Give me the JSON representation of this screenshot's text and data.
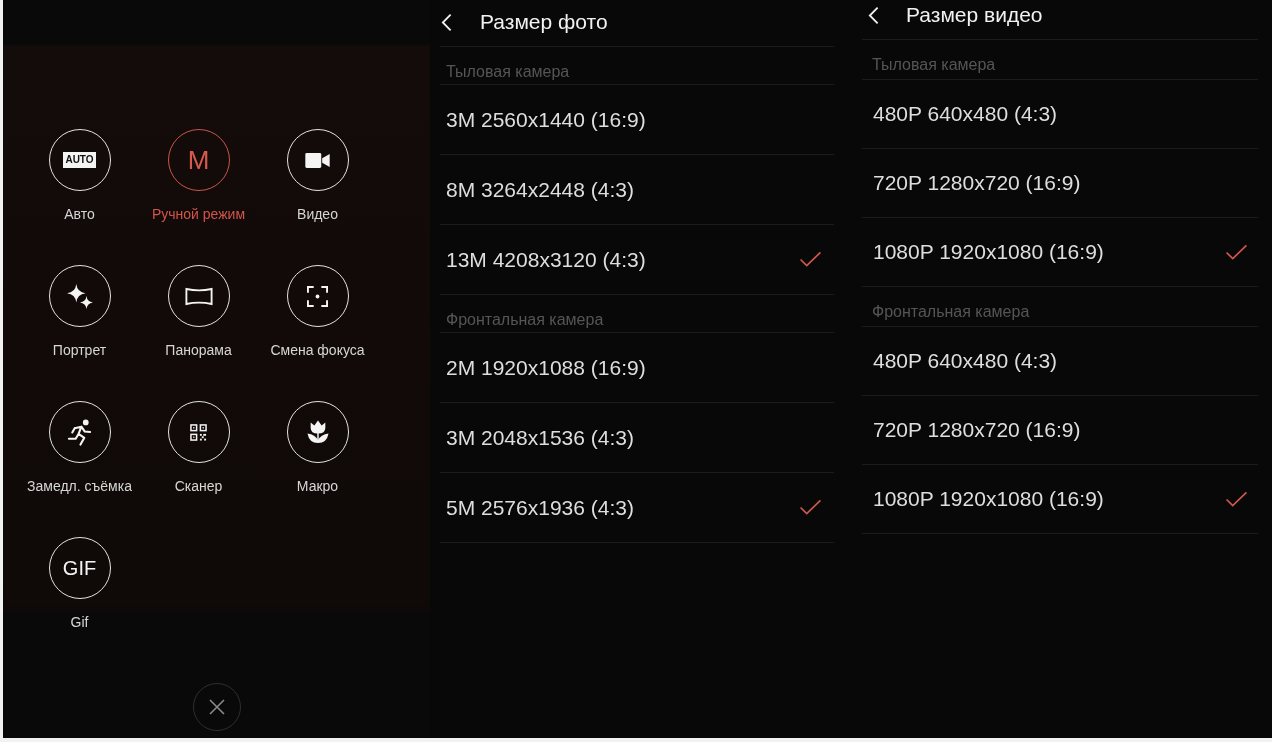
{
  "mode_menu": {
    "modes": [
      {
        "kind": "auto",
        "icon_text": "AUTO",
        "label": "Авто",
        "selected": false
      },
      {
        "kind": "manual",
        "icon_text": "M",
        "label": "Ручной режим",
        "selected": true
      },
      {
        "kind": "video",
        "label": "Видео",
        "selected": false
      },
      {
        "kind": "portrait",
        "label": "Портрет",
        "selected": false
      },
      {
        "kind": "panorama",
        "label": "Панорама",
        "selected": false
      },
      {
        "kind": "refocus",
        "label": "Смена фокуса",
        "selected": false
      },
      {
        "kind": "slowmo",
        "label": "Замедл. съёмка",
        "selected": false
      },
      {
        "kind": "scanner",
        "label": "Сканер",
        "selected": false
      },
      {
        "kind": "macro",
        "label": "Макро",
        "selected": false
      },
      {
        "kind": "gif",
        "icon_text": "GIF",
        "label": "Gif",
        "selected": false
      }
    ]
  },
  "photo_size": {
    "title": "Размер фото",
    "sections": [
      {
        "heading": "Тыловая камера",
        "options": [
          {
            "label": "3M 2560x1440 (16:9)",
            "selected": false
          },
          {
            "label": "8M 3264x2448 (4:3)",
            "selected": false
          },
          {
            "label": "13M 4208x3120 (4:3)",
            "selected": true
          }
        ]
      },
      {
        "heading": "Фронтальная камера",
        "options": [
          {
            "label": "2M 1920x1088 (16:9)",
            "selected": false
          },
          {
            "label": "3M 2048x1536 (4:3)",
            "selected": false
          },
          {
            "label": "5M 2576x1936 (4:3)",
            "selected": true
          }
        ]
      }
    ]
  },
  "video_size": {
    "title": "Размер видео",
    "sections": [
      {
        "heading": "Тыловая камера",
        "options": [
          {
            "label": "480P 640x480 (4:3)",
            "selected": false
          },
          {
            "label": "720P 1280x720 (16:9)",
            "selected": false
          },
          {
            "label": "1080P 1920x1080 (16:9)",
            "selected": true
          }
        ]
      },
      {
        "heading": "Фронтальная камера",
        "options": [
          {
            "label": "480P 640x480 (4:3)",
            "selected": false
          },
          {
            "label": "720P 1280x720 (16:9)",
            "selected": false
          },
          {
            "label": "1080P 1920x1080 (16:9)",
            "selected": true
          }
        ]
      }
    ]
  }
}
